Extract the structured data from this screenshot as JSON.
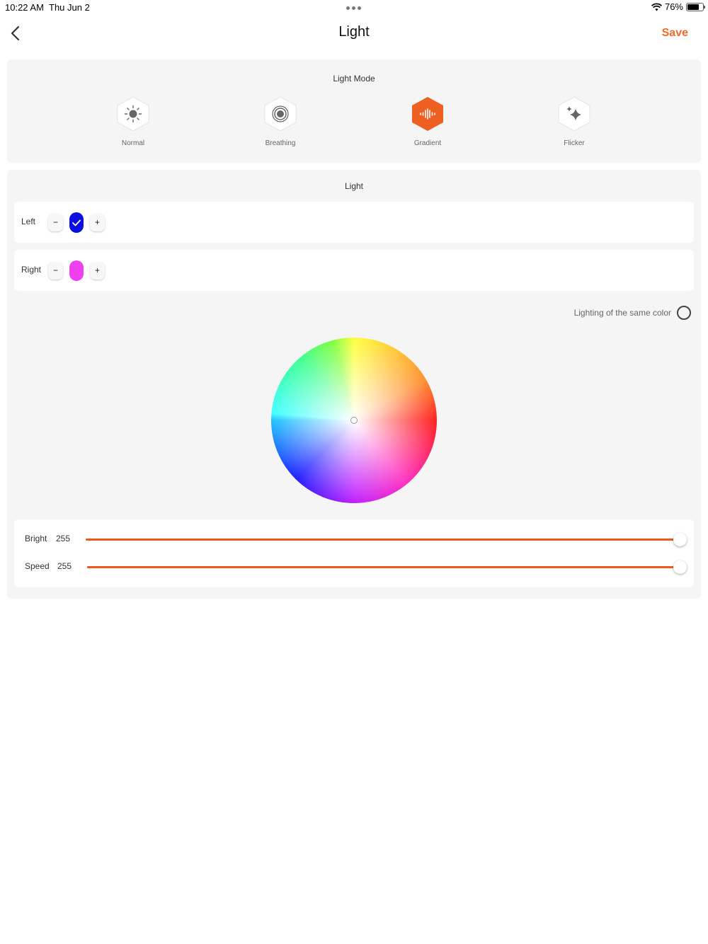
{
  "status_bar": {
    "time": "10:22 AM",
    "date": "Thu Jun 2",
    "battery": "76%",
    "battery_level": 0.76
  },
  "header": {
    "title": "Light",
    "save_label": "Save"
  },
  "light_mode": {
    "title": "Light Mode",
    "selected": "Gradient",
    "items": [
      {
        "label": "Normal",
        "icon": "sun-icon"
      },
      {
        "label": "Breathing",
        "icon": "breathing-icon"
      },
      {
        "label": "Gradient",
        "icon": "gradient-icon"
      },
      {
        "label": "Flicker",
        "icon": "sparkle-icon"
      }
    ]
  },
  "light": {
    "title": "Light",
    "rows": [
      {
        "label": "Left",
        "minus": "−",
        "plus": "+",
        "color": "#0a10e0",
        "selected": true
      },
      {
        "label": "Right",
        "minus": "−",
        "plus": "+",
        "color": "#ee40f0",
        "selected": false
      }
    ],
    "same_color_label": "Lighting of the same color",
    "same_color_checked": false
  },
  "sliders": [
    {
      "label": "Bright",
      "value": "255",
      "level": 1.0
    },
    {
      "label": "Speed",
      "value": "255",
      "level": 1.0
    }
  ],
  "colors": {
    "accent": "#f06a2a",
    "panel": "#f5f5f5"
  }
}
